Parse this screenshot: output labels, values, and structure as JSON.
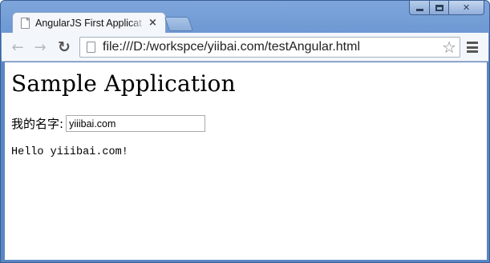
{
  "browser": {
    "tab": {
      "title": "AngularJS First Applicat",
      "close_glyph": "×"
    },
    "toolbar": {
      "back_glyph": "←",
      "forward_glyph": "→",
      "reload_glyph": "↻",
      "url": "file:///D:/workspce/yiibai.com/testAngular.html",
      "star_glyph": "☆"
    },
    "caption": {
      "close_glyph": "✕"
    },
    "icons": {
      "tab": "page-icon",
      "back": "arrow-left-icon",
      "forward": "arrow-right-icon",
      "reload": "reload-icon",
      "url": "page-icon",
      "bookmark": "star-icon",
      "menu": "hamburger-menu-icon",
      "minimize": "minimize-icon",
      "maximize": "maximize-icon",
      "close": "close-icon"
    }
  },
  "page": {
    "heading": "Sample Application",
    "name_label": "我的名字:",
    "name_value": "yiiibai.com",
    "greeting": "Hello yiiibai.com!"
  }
}
